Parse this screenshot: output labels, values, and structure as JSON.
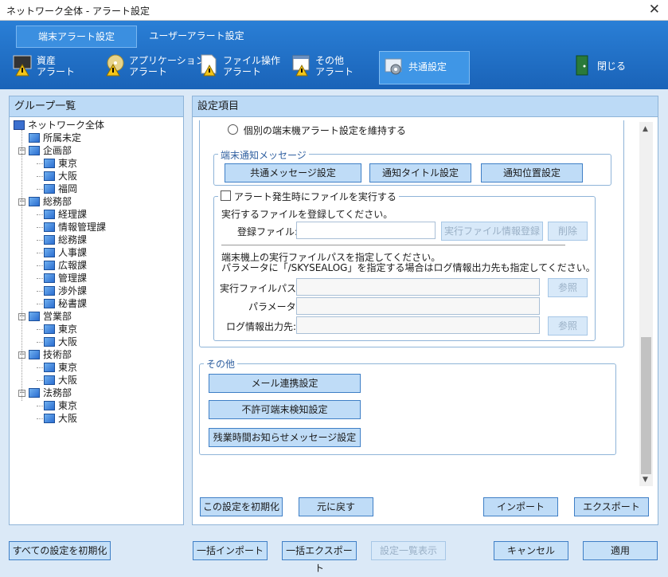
{
  "window": {
    "title": "ネットワーク全体 - アラート設定",
    "close_glyph": "✕"
  },
  "tabs": [
    {
      "label": "端末アラート設定"
    },
    {
      "label": "ユーザーアラート設定"
    }
  ],
  "toolbar": {
    "asset": {
      "line1": "資産",
      "line2": "アラート"
    },
    "app": {
      "line1": "アプリケーション",
      "line2": "アラート"
    },
    "file": {
      "line1": "ファイル操作",
      "line2": "アラート"
    },
    "other": {
      "line1": "その他",
      "line2": "アラート"
    },
    "common": {
      "label": "共通設定"
    },
    "close": {
      "label": "閉じる"
    }
  },
  "group_panel": {
    "title": "グループ一覧",
    "tree": [
      "ネットワーク全体",
      "所属未定",
      "企画部",
      "東京",
      "大阪",
      "福岡",
      "総務部",
      "経理課",
      "情報管理課",
      "総務課",
      "人事課",
      "広報課",
      "管理課",
      "渉外課",
      "秘書課",
      "営業部",
      "東京",
      "大阪",
      "技術部",
      "東京",
      "大阪",
      "法務部",
      "東京",
      "大阪"
    ]
  },
  "settings_panel": {
    "title": "設定項目",
    "keep_individual_radio": "個別の端末機アラート設定を維持する",
    "notify": {
      "legend": "端末通知メッセージ",
      "btn_common": "共通メッセージ設定",
      "btn_title": "通知タイトル設定",
      "btn_position": "通知位置設定"
    },
    "exec": {
      "legend": "アラート発生時にファイルを実行する",
      "instruction": "実行するファイルを登録してください。",
      "reg_label": "登録ファイル:",
      "reg_value": "",
      "btn_exec_info": "実行ファイル情報登録",
      "btn_delete": "削除",
      "note1": "端末機上の実行ファイルパスを指定してください。",
      "note2": "パラメータに「/SKYSEALOG」を指定する場合はログ情報出力先も指定してください。",
      "path_label": "実行ファイルパス:",
      "param_label": "パラメータ:",
      "log_label": "ログ情報出力先:",
      "btn_browse": "参照"
    },
    "other": {
      "legend": "その他",
      "btn_mail": "メール連携設定",
      "btn_unauth": "不許可端末検知設定",
      "btn_overtime": "残業時間お知らせメッセージ設定"
    },
    "btn_reset": "この設定を初期化",
    "btn_revert": "元に戻す",
    "btn_import": "インポート",
    "btn_export": "エクスポート"
  },
  "footer": {
    "btn_reset_all": "すべての設定を初期化",
    "btn_bulk_import": "一括インポート",
    "btn_bulk_export": "一括エクスポート",
    "btn_list": "設定一覧表示",
    "btn_cancel": "キャンセル",
    "btn_apply": "適用"
  },
  "colors": {
    "header": "#1f6ec4",
    "accent": "#3f7fc6",
    "panel_head": "#bcdaf6"
  }
}
